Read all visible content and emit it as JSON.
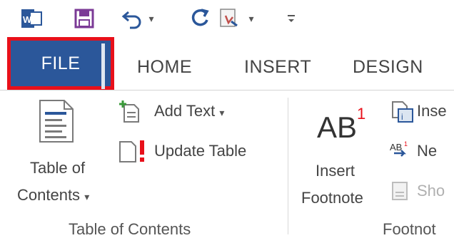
{
  "qat": {
    "icons": [
      "word-app-icon",
      "save-icon",
      "undo-icon",
      "redo-icon",
      "touch-mode-icon",
      "customize-qat-icon"
    ]
  },
  "tabs": {
    "file": "FILE",
    "home": "HOME",
    "insert": "INSERT",
    "design": "DESIGN"
  },
  "ribbon": {
    "toc_group": {
      "toc_button_line1": "Table of",
      "toc_button_line2": "Contents",
      "add_text": "Add Text",
      "update_table": "Update Table",
      "group_label": "Table of Contents"
    },
    "footnotes_group": {
      "insert_footnote_line1": "Insert",
      "insert_footnote_line2": "Footnote",
      "footnote_icon_text": "AB",
      "footnote_icon_sup": "1",
      "insert_endnote": "Inse",
      "next_footnote": "Ne",
      "show_notes": "Sho",
      "group_label": "Footnot"
    }
  },
  "colors": {
    "file_tab_bg": "#2b579a",
    "highlight_border": "#e8101a"
  }
}
